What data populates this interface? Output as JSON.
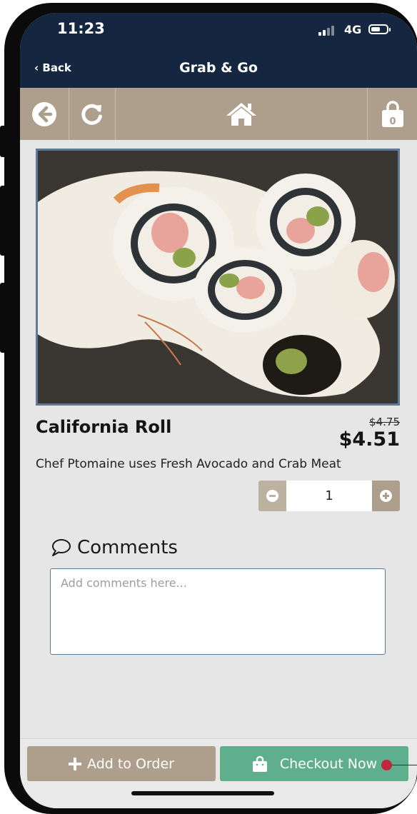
{
  "status_bar": {
    "time": "11:23",
    "network": "4G"
  },
  "nav": {
    "back_label": "Back",
    "title": "Grab & Go"
  },
  "toolbar": {
    "cart_count": "0"
  },
  "product": {
    "name": "California Roll",
    "original_price": "$4.75",
    "price": "$4.51",
    "description": "Chef Ptomaine uses Fresh Avocado and Crab Meat"
  },
  "quantity": {
    "value": "1"
  },
  "comments": {
    "heading": "Comments",
    "placeholder": "Add comments here..."
  },
  "actions": {
    "add_label": "Add to Order",
    "checkout_label": "Checkout Now"
  },
  "colors": {
    "header": "#142640",
    "toolbar": "#ad9f8b",
    "checkout": "#5fae8e",
    "accent_border": "#5f7a97"
  }
}
